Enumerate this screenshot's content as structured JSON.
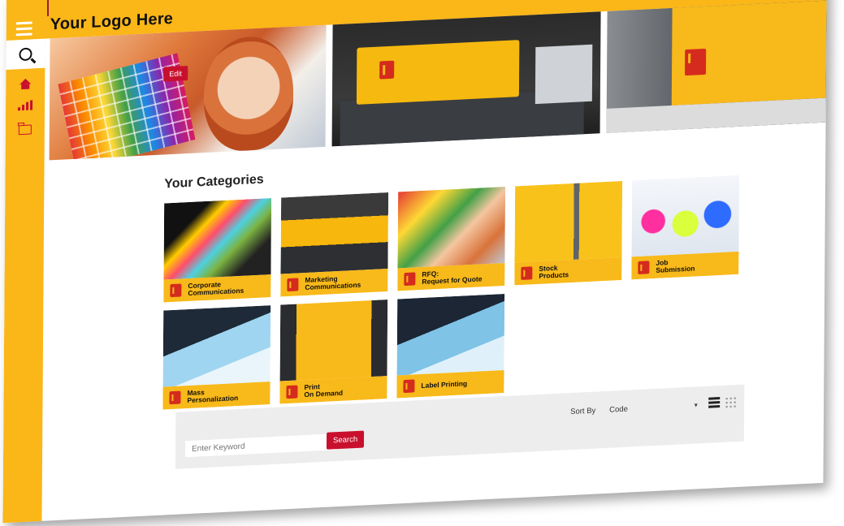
{
  "header": {
    "logo_text": "Your Logo Here"
  },
  "banner": {
    "edit_label": "Edit"
  },
  "categories": {
    "title": "Your Categories",
    "items": [
      {
        "label": "Corporate\nCommunications"
      },
      {
        "label": "Marketing\nCommunications"
      },
      {
        "label": "RFQ:\nRequest for Quote"
      },
      {
        "label": "Stock\nProducts"
      },
      {
        "label": "Job\nSubmission"
      },
      {
        "label": "Mass\nPersonalization"
      },
      {
        "label": "Print\nOn Demand"
      },
      {
        "label": "Label Printing"
      }
    ]
  },
  "search": {
    "placeholder": "Enter Keyword",
    "button_label": "Search",
    "sort_label": "Sort By",
    "sort_value": "Code"
  },
  "colors": {
    "brand_yellow": "#fbb617",
    "accent_red": "#c8102e"
  },
  "icons": {
    "top": [
      "user-icon",
      "dollar-icon",
      "cart-icon",
      "help-icon",
      "logout-icon"
    ],
    "sidebar": [
      "search-icon",
      "home-icon",
      "bar-chart-icon",
      "folder-icon"
    ]
  }
}
